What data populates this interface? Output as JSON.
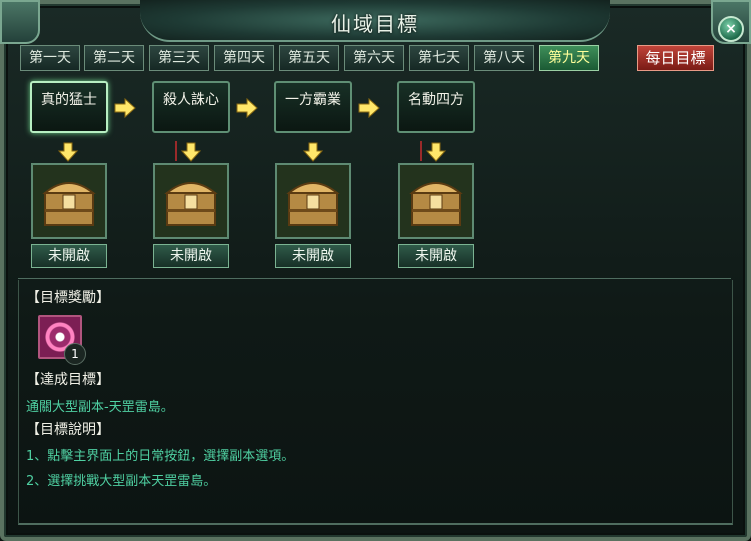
{
  "window": {
    "title": "仙域目標"
  },
  "tabs": [
    "第一天",
    "第二天",
    "第三天",
    "第四天",
    "第五天",
    "第六天",
    "第七天",
    "第八天",
    "第九天"
  ],
  "active_tab": "第九天",
  "daily_button": "每日目標",
  "stages": [
    {
      "name": "真的猛士",
      "status": "未開啟"
    },
    {
      "name": "殺人誅心",
      "status": "未開啟"
    },
    {
      "name": "一方霸業",
      "status": "未開啟"
    },
    {
      "name": "名動四方",
      "status": "未開啟"
    }
  ],
  "reward_section": {
    "heading": "【目標獎勵】",
    "reward_count": "1"
  },
  "goal_section": {
    "heading": "【達成目標】",
    "text": "通關大型副本-天罡雷島。"
  },
  "desc_section": {
    "heading": "【目標說明】",
    "lines": [
      "1、點擊主界面上的日常按鈕，選擇副本選項。",
      "2、選擇挑戰大型副本天罡雷島。"
    ]
  },
  "colors": {
    "accent": "#4fd0a2",
    "tab_active": "#1b5a34",
    "daily_red": "#a12a22"
  }
}
